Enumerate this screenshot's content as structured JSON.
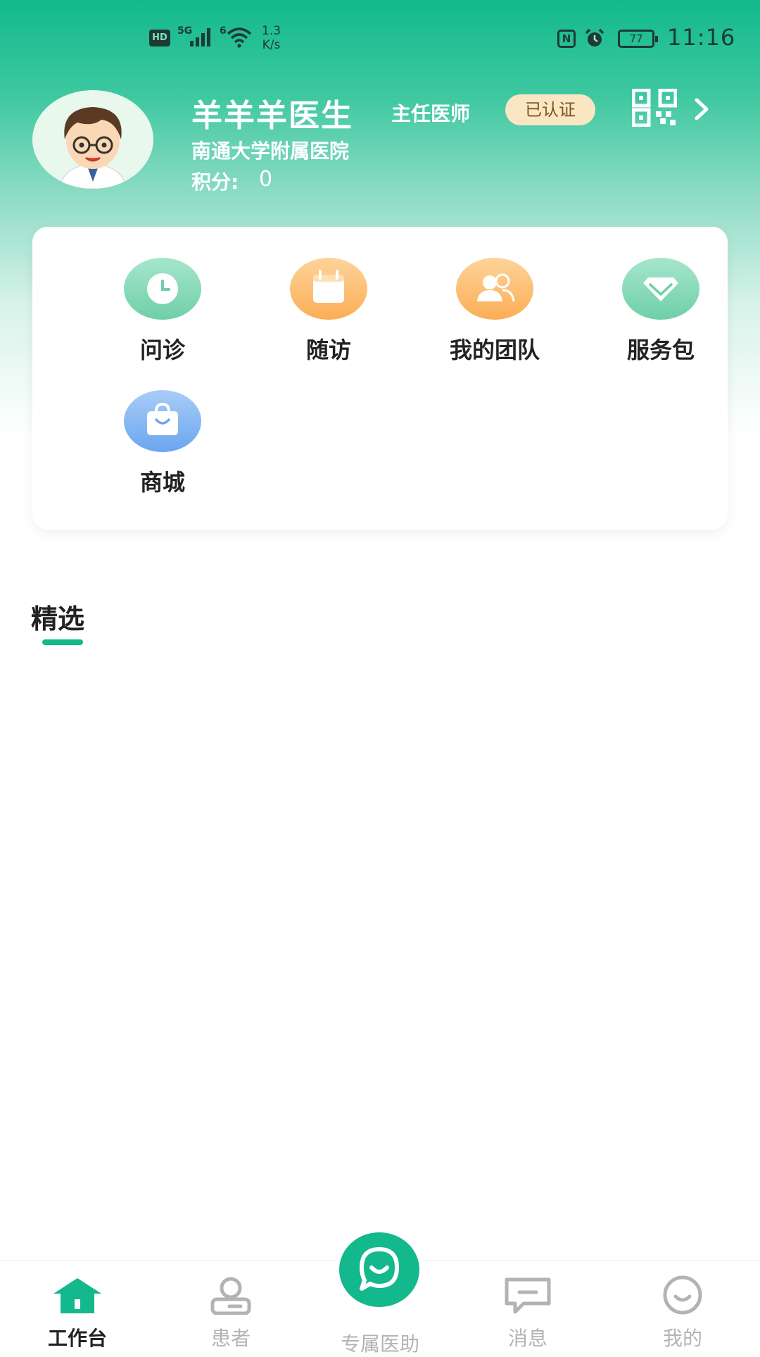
{
  "status_bar": {
    "hd": "HD",
    "signal_label": "5G",
    "wifi_label": "6",
    "speed_value": "1.3",
    "speed_unit": "K/s",
    "nfc": "N",
    "battery": "77",
    "time": "11:16"
  },
  "profile": {
    "name": "羊羊羊医生",
    "title": "主任医师",
    "badge": "已认证",
    "hospital": "南通大学附属医院",
    "points_label": "积分:",
    "points_value": "0"
  },
  "services": [
    {
      "label": "问诊",
      "icon": "clock-icon",
      "color": "#7fd7b6"
    },
    {
      "label": "随访",
      "icon": "calendar-icon",
      "color": "#fdbb6b"
    },
    {
      "label": "我的团队",
      "icon": "team-icon",
      "color": "#fdbb6b"
    },
    {
      "label": "服务包",
      "icon": "diamond-icon",
      "color": "#7fd7b6"
    },
    {
      "label": "商城",
      "icon": "shopping-bag-icon",
      "color": "#86b7f3"
    }
  ],
  "section": {
    "title": "精选"
  },
  "tabbar": {
    "items": [
      {
        "label": "工作台",
        "icon": "home-icon",
        "active": true
      },
      {
        "label": "患者",
        "icon": "patient-icon",
        "active": false
      },
      {
        "label": "专属医助",
        "icon": "chat-smile-icon",
        "active": false
      },
      {
        "label": "消息",
        "icon": "message-icon",
        "active": false
      },
      {
        "label": "我的",
        "icon": "smile-icon",
        "active": false
      }
    ]
  },
  "colors": {
    "accent": "#14b88d",
    "badge_bg": "#fbe6c3",
    "inactive": "#b3b3b3"
  }
}
